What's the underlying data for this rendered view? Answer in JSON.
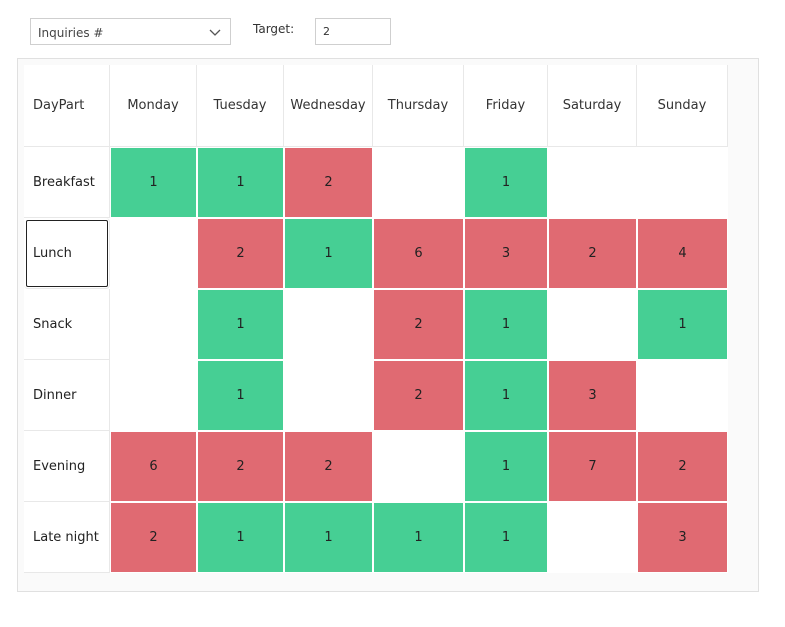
{
  "toolbar": {
    "metric_select": {
      "value": "Inquiries #"
    },
    "target_label": "Target:",
    "target_value": "2"
  },
  "grid": {
    "corner_label": "DayPart",
    "days": [
      "Monday",
      "Tuesday",
      "Wednesday",
      "Thursday",
      "Friday",
      "Saturday",
      "Sunday"
    ],
    "selected_row": 1,
    "rows": [
      {
        "label": "Breakfast",
        "values": [
          "1",
          "1",
          "2",
          "",
          "1",
          "",
          ""
        ]
      },
      {
        "label": "Lunch",
        "values": [
          "",
          "2",
          "1",
          "6",
          "3",
          "2",
          "4"
        ]
      },
      {
        "label": "Snack",
        "values": [
          "",
          "1",
          "",
          "2",
          "1",
          "",
          "1"
        ]
      },
      {
        "label": "Dinner",
        "values": [
          "",
          "1",
          "",
          "2",
          "1",
          "3",
          ""
        ]
      },
      {
        "label": "Evening",
        "values": [
          "6",
          "2",
          "2",
          "",
          "1",
          "7",
          "2"
        ]
      },
      {
        "label": "Late night",
        "values": [
          "2",
          "1",
          "1",
          "1",
          "1",
          "",
          "3"
        ]
      }
    ]
  },
  "colors": {
    "above_target": "#e06a72",
    "below_target": "#46cf94"
  },
  "icons": {
    "dropdown": "chevron-down-icon"
  }
}
